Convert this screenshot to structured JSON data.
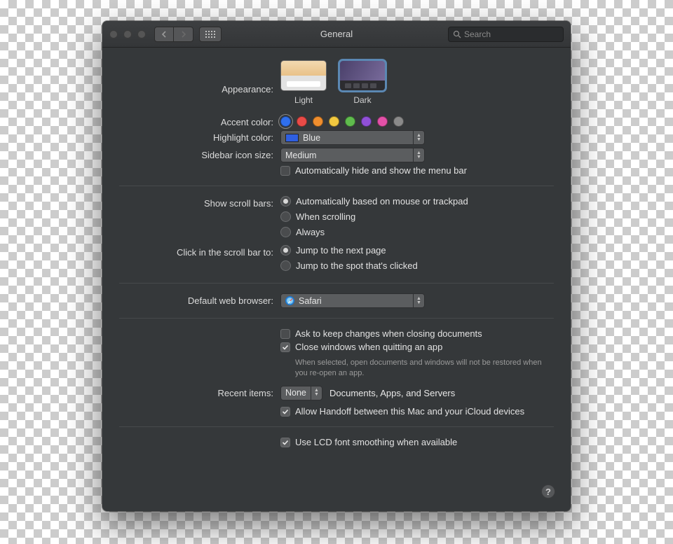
{
  "window": {
    "title": "General"
  },
  "search": {
    "placeholder": "Search"
  },
  "appearance": {
    "label": "Appearance:",
    "light": "Light",
    "dark": "Dark",
    "selected": "dark"
  },
  "accent": {
    "label": "Accent color:"
  },
  "highlight": {
    "label": "Highlight color:",
    "value": "Blue"
  },
  "sidebar": {
    "label": "Sidebar icon size:",
    "value": "Medium"
  },
  "menubar": {
    "checkbox": "Automatically hide and show the menu bar",
    "checked": false
  },
  "scrollbars": {
    "label": "Show scroll bars:",
    "opt1": "Automatically based on mouse or trackpad",
    "opt2": "When scrolling",
    "opt3": "Always"
  },
  "scrollclick": {
    "label": "Click in the scroll bar to:",
    "opt1": "Jump to the next page",
    "opt2": "Jump to the spot that's clicked"
  },
  "browser": {
    "label": "Default web browser:",
    "value": "Safari"
  },
  "ask_changes": {
    "label": "Ask to keep changes when closing documents",
    "checked": false
  },
  "close_windows": {
    "label": "Close windows when quitting an app",
    "checked": true,
    "hint": "When selected, open documents and windows will not be restored when you re-open an app."
  },
  "recent": {
    "label": "Recent items:",
    "value": "None",
    "suffix": "Documents, Apps, and Servers"
  },
  "handoff": {
    "label": "Allow Handoff between this Mac and your iCloud devices",
    "checked": true
  },
  "lcd": {
    "label": "Use LCD font smoothing when available",
    "checked": true
  }
}
